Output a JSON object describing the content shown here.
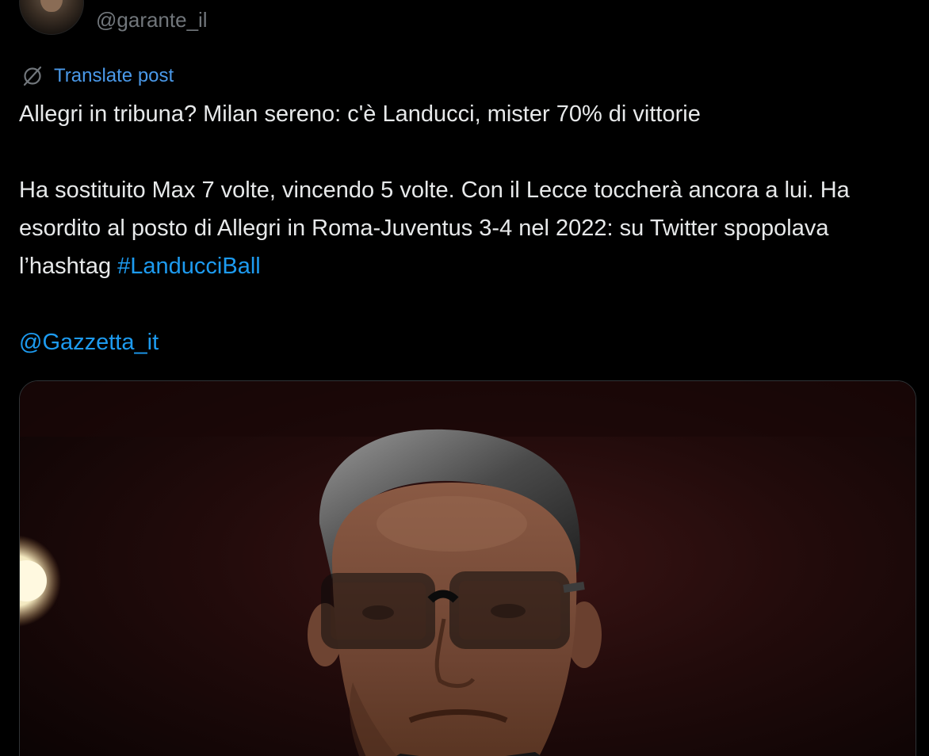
{
  "author": {
    "handle": "@garante_il",
    "avatar_icon": "user-avatar"
  },
  "translate": {
    "icon": "globe-slash-icon",
    "label": "Translate post"
  },
  "post": {
    "headline": "Allegri in tribuna? Milan sereno: c'è Landucci, mister 70% di vittorie",
    "body_text": "Ha sostituito Max 7 volte, vincendo 5 volte. Con il Lecce toccherà ancora a lui. Ha esordito al posto di Allegri in Roma-Juventus 3-4 nel 2022: su Twitter spopolava l’hashtag ",
    "hashtag": "#LanducciBall",
    "mention": "@Gazzetta_it"
  },
  "colors": {
    "background": "#000000",
    "text": "#e7e9ea",
    "muted": "#71767b",
    "link": "#1d9bf0"
  }
}
